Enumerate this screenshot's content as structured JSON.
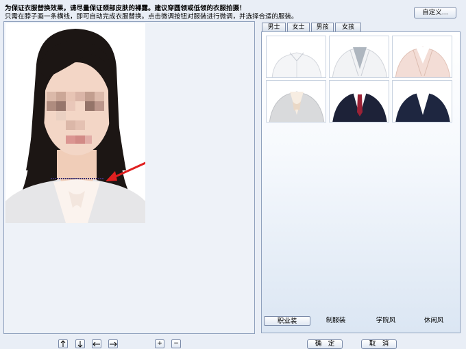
{
  "header": {
    "line1": "为保证衣服替换效果，请尽量保证颈部皮肤的裸露。建议穿圆领或低领的衣服拍摄！",
    "line2": "只需在脖子画一条横线，即可自动完成衣服替换。点击微调按钮对服装进行微调，并选择合适的服装。",
    "custom_button": "自定义..."
  },
  "tabs": [
    {
      "label": "男士"
    },
    {
      "label": "女士"
    },
    {
      "label": "男孩"
    },
    {
      "label": "女孩"
    }
  ],
  "categories": [
    {
      "label": "职业装",
      "active": true
    },
    {
      "label": "制服装",
      "active": false
    },
    {
      "label": "学院风",
      "active": false
    },
    {
      "label": "休闲风",
      "active": false
    }
  ],
  "toolbar": {
    "up_icon": "up-arrow-icon",
    "down_icon": "down-arrow-icon",
    "left_icon": "left-arrow-icon",
    "right_icon": "right-arrow-icon",
    "zoom_in_label": "+",
    "zoom_out_label": "−"
  },
  "actions": {
    "ok_label": "确　定",
    "cancel_label": "取　消"
  },
  "clothes": [
    {
      "name": "white-blouse",
      "color": "#f4f5f7"
    },
    {
      "name": "white-blazer-grey-shirt",
      "color": "#f2f3f5"
    },
    {
      "name": "pink-blazer",
      "color": "#f3ddd6"
    },
    {
      "name": "grey-blazer-bow",
      "color": "#d9dadc"
    },
    {
      "name": "navy-suit-red-tie",
      "color": "#1d2238"
    },
    {
      "name": "navy-suit-white-shirt",
      "color": "#1e2640"
    }
  ],
  "colors": {
    "accent_arrow": "#e02020",
    "panel_border": "#8fa1bd",
    "background": "#e9eef6"
  }
}
